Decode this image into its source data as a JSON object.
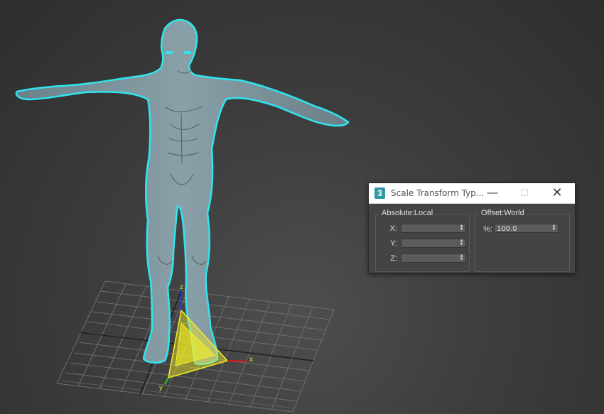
{
  "viewport": {
    "axis_labels": {
      "x": "x",
      "y": "y",
      "z": "z"
    },
    "selection_color": "#2fe6f0",
    "gizmo_color": "#f5ee27",
    "model_color": "#7d949c"
  },
  "dialog": {
    "app_icon": "3",
    "title": "Scale Transform Typ...",
    "minimize_icon": "minimize-icon",
    "maximize_icon": "maximize-icon",
    "close_icon": "close-icon",
    "absolute_group": {
      "label": "Absolute:Local",
      "fields": [
        {
          "label": "X:",
          "value": ""
        },
        {
          "label": "Y:",
          "value": ""
        },
        {
          "label": "Z:",
          "value": ""
        }
      ]
    },
    "offset_group": {
      "label": "Offset:World",
      "field": {
        "label": "%:",
        "value": "100.0"
      }
    }
  }
}
